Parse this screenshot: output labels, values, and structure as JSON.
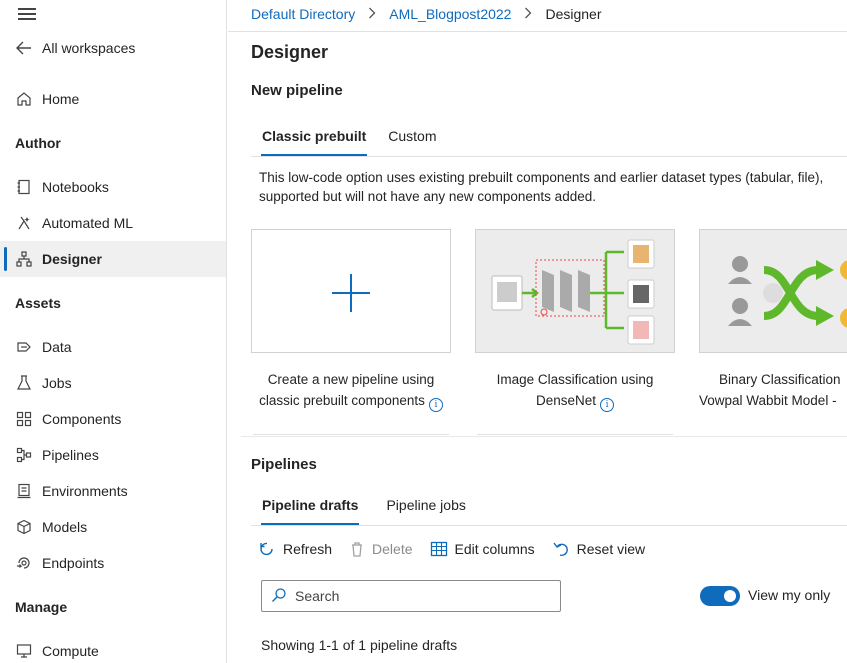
{
  "sidebar": {
    "back_label": "All workspaces",
    "home_label": "Home",
    "sections": {
      "author": "Author",
      "assets": "Assets",
      "manage": "Manage"
    },
    "author_items": [
      {
        "label": "Notebooks",
        "icon": "notebook-icon"
      },
      {
        "label": "Automated ML",
        "icon": "automl-icon"
      },
      {
        "label": "Designer",
        "icon": "designer-icon",
        "active": true
      }
    ],
    "asset_items": [
      {
        "label": "Data",
        "icon": "data-icon"
      },
      {
        "label": "Jobs",
        "icon": "jobs-icon"
      },
      {
        "label": "Components",
        "icon": "components-icon"
      },
      {
        "label": "Pipelines",
        "icon": "pipelines-icon"
      },
      {
        "label": "Environments",
        "icon": "environments-icon"
      },
      {
        "label": "Models",
        "icon": "models-icon"
      },
      {
        "label": "Endpoints",
        "icon": "endpoints-icon"
      }
    ],
    "manage_items": [
      {
        "label": "Compute",
        "icon": "compute-icon"
      }
    ]
  },
  "breadcrumb": [
    "Default Directory",
    "AML_Blogpost2022",
    "Designer"
  ],
  "page": {
    "title": "Designer",
    "new_pipeline_heading": "New pipeline",
    "tabs": [
      "Classic prebuilt",
      "Custom"
    ],
    "description_line1": "This low-code option uses existing prebuilt components and earlier dataset types (tabular, file),",
    "description_line2": "supported but will not have any new components added."
  },
  "cards": [
    {
      "line1": "Create a new pipeline using",
      "line2": "classic prebuilt components"
    },
    {
      "line1": "Image Classification using",
      "line2": "DenseNet"
    },
    {
      "line1": "Binary Classification",
      "line2": "Vowpal Wabbit Model -"
    }
  ],
  "pipelines": {
    "heading": "Pipelines",
    "tabs": [
      "Pipeline drafts",
      "Pipeline jobs"
    ],
    "toolbar": {
      "refresh": "Refresh",
      "delete": "Delete",
      "edit_columns": "Edit columns",
      "reset_view": "Reset view"
    },
    "search_placeholder": "Search",
    "view_my_only_label": "View my only",
    "view_my_only_on": true,
    "showing_text": "Showing 1-1 of 1 pipeline drafts"
  },
  "colors": {
    "accent": "#0f6cbd",
    "border": "#e1e1e1"
  }
}
